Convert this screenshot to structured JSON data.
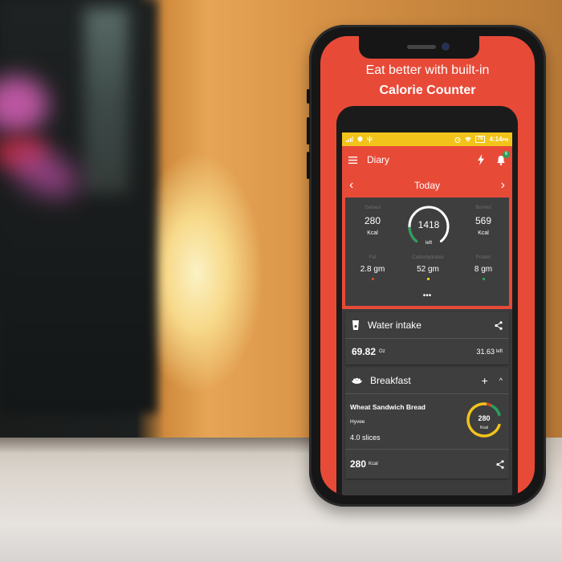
{
  "promo": {
    "line1": "Eat better with built-in",
    "line2": "Calorie Counter"
  },
  "statusbar": {
    "time": "4:14",
    "ampm": "PM",
    "battery": "76",
    "icons": [
      "signal-icon",
      "location-icon",
      "usb-icon",
      "alarm-icon",
      "wifi-icon",
      "battery-icon"
    ]
  },
  "toolbar": {
    "title": "Diary",
    "notification_count": "6",
    "colors": {
      "primary": "#e84a38",
      "statusbar": "#f2c31a",
      "badge": "#2aa05a"
    }
  },
  "datebar": {
    "label": "Today",
    "prev": "‹",
    "next": "›"
  },
  "summary": {
    "gained": {
      "label": "Gained",
      "value": "280",
      "unit": "Kcal"
    },
    "burned": {
      "label": "Burned",
      "value": "569",
      "unit": "Kcal"
    },
    "remaining": {
      "value": "1418",
      "label": "left",
      "progress_fraction": 0.16
    },
    "macros": [
      {
        "label": "Fat",
        "value": "2.8 gm",
        "color": "#d9442f"
      },
      {
        "label": "Carbohydrates",
        "value": "52 gm",
        "color": "#f2c31a"
      },
      {
        "label": "Protein",
        "value": "8 gm",
        "color": "#2aa05a"
      }
    ],
    "more": "•••"
  },
  "water": {
    "title": "Water intake",
    "value": "69.82",
    "unit": "Oz",
    "left_value": "31.63",
    "left_label": "left"
  },
  "breakfast": {
    "title": "Breakfast",
    "add": "+",
    "collapse": "^",
    "items": [
      {
        "name": "Wheat Sandwich Bread",
        "brand": "Hyvee",
        "quantity": "4.0  slices",
        "kcal": "280",
        "kcal_unit": "Kcal",
        "macro_split": {
          "carbs": 0.8,
          "fat": 0.05,
          "protein": 0.15
        }
      }
    ],
    "total": "280",
    "total_unit": "Kcal"
  }
}
